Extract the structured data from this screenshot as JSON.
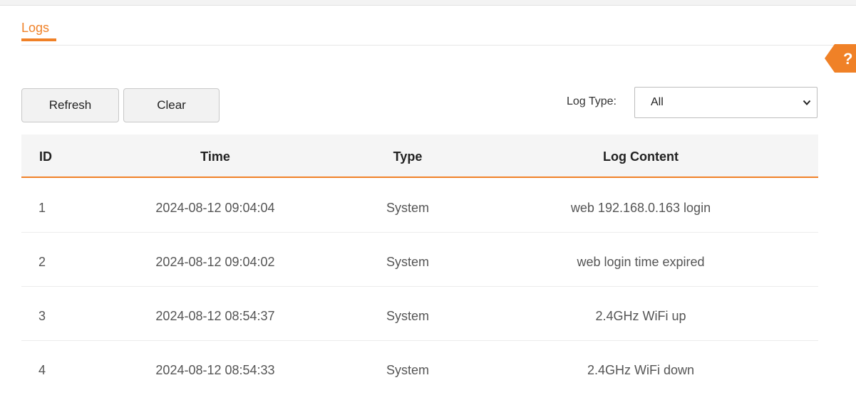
{
  "tabs": [
    {
      "label": "Logs",
      "active": true
    }
  ],
  "help": {
    "icon": "question-mark-icon",
    "glyph": "?",
    "color": "#f08127"
  },
  "toolbar": {
    "refresh_label": "Refresh",
    "clear_label": "Clear",
    "log_type_label": "Log Type:",
    "log_type_value": "All"
  },
  "table": {
    "columns": [
      "ID",
      "Time",
      "Type",
      "Log Content"
    ],
    "rows": [
      {
        "id": "1",
        "time": "2024-08-12 09:04:04",
        "type": "System",
        "content": "web 192.168.0.163 login"
      },
      {
        "id": "2",
        "time": "2024-08-12 09:04:02",
        "type": "System",
        "content": "web login time expired"
      },
      {
        "id": "3",
        "time": "2024-08-12 08:54:37",
        "type": "System",
        "content": "2.4GHz WiFi up"
      },
      {
        "id": "4",
        "time": "2024-08-12 08:54:33",
        "type": "System",
        "content": "2.4GHz WiFi down"
      }
    ]
  },
  "colors": {
    "accent": "#f08127",
    "header_bg": "#f5f5f5",
    "button_bg": "#f2f2f2"
  }
}
